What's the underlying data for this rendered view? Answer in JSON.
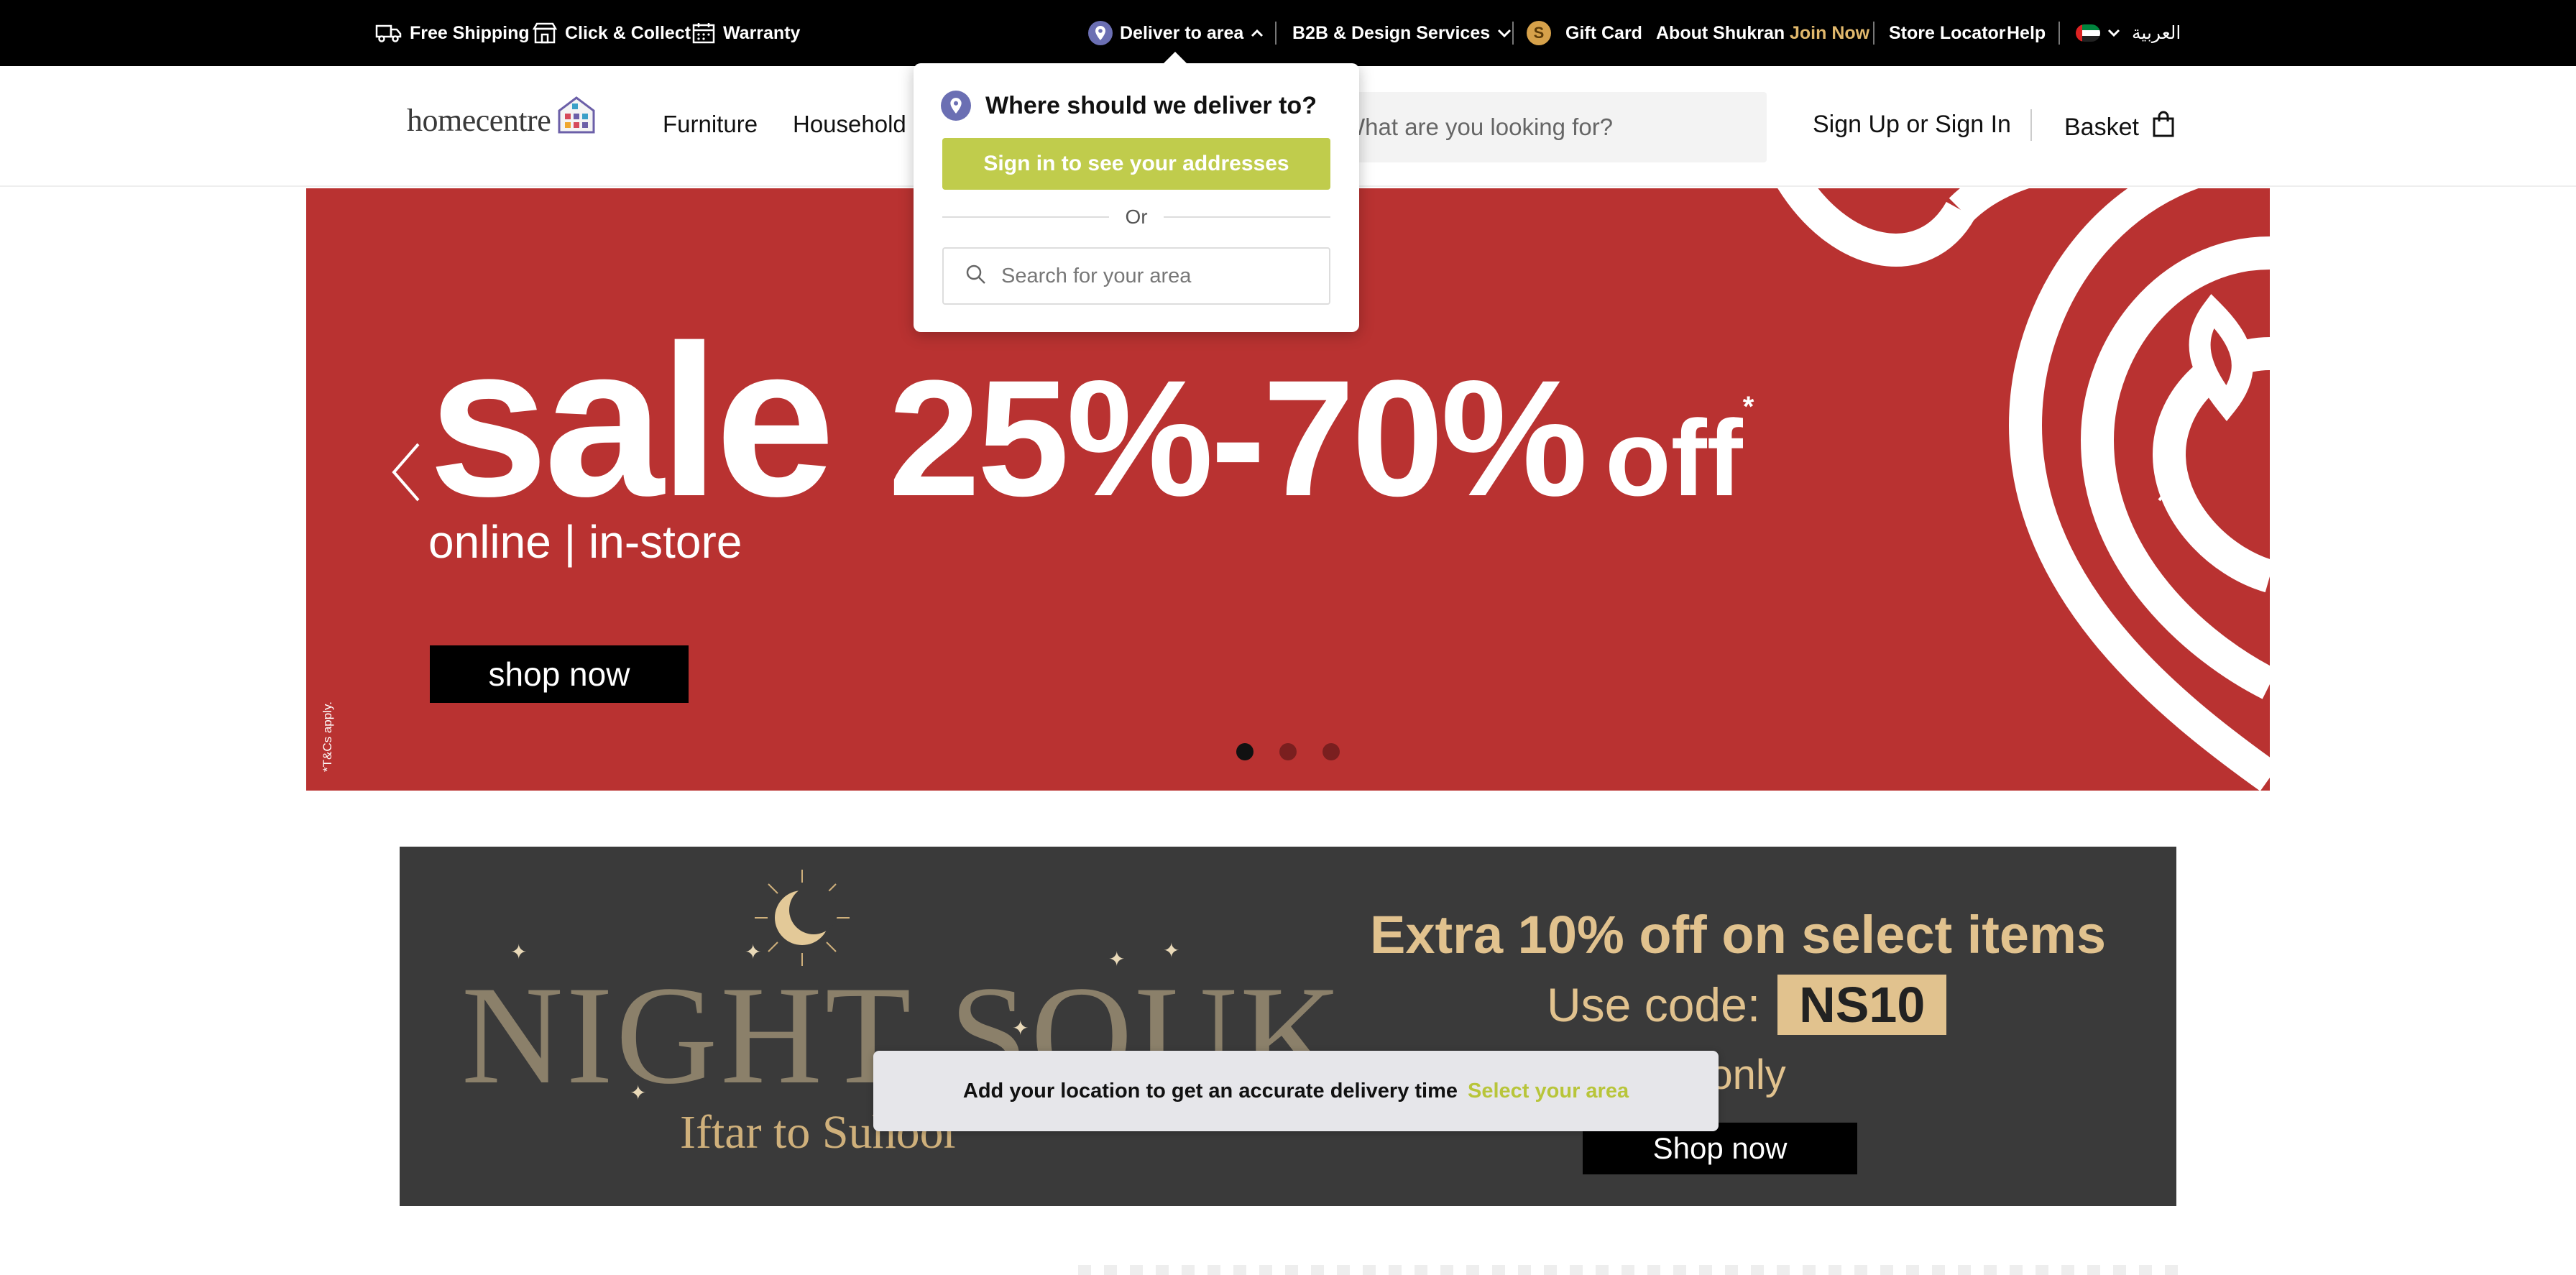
{
  "topbar": {
    "free_shipping": "Free Shipping",
    "click_collect": "Click & Collect",
    "warranty": "Warranty",
    "deliver_to": "Deliver to area",
    "b2b": "B2B & Design Services",
    "gift_card": "Gift Card",
    "about_shukran": "About Shukran",
    "join_now": "Join Now",
    "store_locator": "Store Locator",
    "help": "Help",
    "language": "العربية",
    "coin_symbol": "S"
  },
  "header": {
    "logo": "homecentre",
    "nav": [
      "Furniture",
      "Household"
    ],
    "search_placeholder": "What are you looking for?",
    "sign_in": "Sign Up or Sign In",
    "basket": "Basket"
  },
  "deliver_popup": {
    "title": "Where should we deliver to?",
    "sign_in_button": "Sign in to see your addresses",
    "or": "Or",
    "search_placeholder": "Search for your area"
  },
  "hero": {
    "sale": "sale",
    "range": "25%-70%",
    "off": "off",
    "asterisk": "*",
    "subtitle": "online | in-store",
    "button": "shop now",
    "terms": "*T&Cs apply.",
    "active_slide": 1,
    "slide_count": 3
  },
  "souk": {
    "title": "NIGHT SOUK",
    "subtitle": "Iftar to Suhoor",
    "headline": "Extra 10% off on select items",
    "code_label": "Use code:",
    "code": "NS10",
    "note": "e only",
    "button": "Shop now"
  },
  "toast": {
    "message": "Add your location to get an accurate delivery time",
    "link": "Select your area"
  },
  "colors": {
    "hero_red": "#b93231",
    "accent_green": "#c0cc4c",
    "gold": "#e1c28e",
    "join_gold": "#e1b86c"
  }
}
